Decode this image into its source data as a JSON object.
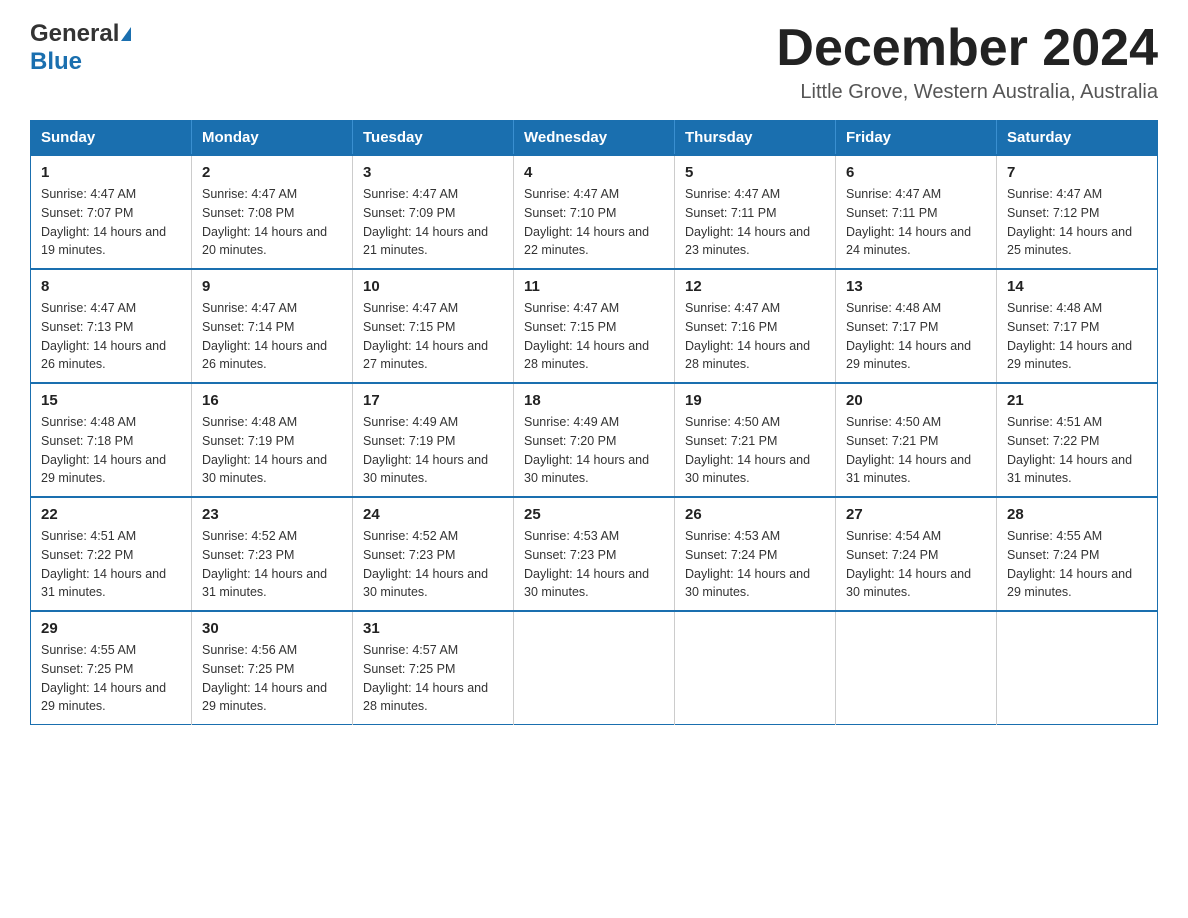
{
  "header": {
    "logo_line1": "General",
    "logo_line2": "Blue",
    "month_title": "December 2024",
    "location": "Little Grove, Western Australia, Australia"
  },
  "days_of_week": [
    "Sunday",
    "Monday",
    "Tuesday",
    "Wednesday",
    "Thursday",
    "Friday",
    "Saturday"
  ],
  "weeks": [
    [
      {
        "num": "1",
        "sunrise": "4:47 AM",
        "sunset": "7:07 PM",
        "daylight": "14 hours and 19 minutes."
      },
      {
        "num": "2",
        "sunrise": "4:47 AM",
        "sunset": "7:08 PM",
        "daylight": "14 hours and 20 minutes."
      },
      {
        "num": "3",
        "sunrise": "4:47 AM",
        "sunset": "7:09 PM",
        "daylight": "14 hours and 21 minutes."
      },
      {
        "num": "4",
        "sunrise": "4:47 AM",
        "sunset": "7:10 PM",
        "daylight": "14 hours and 22 minutes."
      },
      {
        "num": "5",
        "sunrise": "4:47 AM",
        "sunset": "7:11 PM",
        "daylight": "14 hours and 23 minutes."
      },
      {
        "num": "6",
        "sunrise": "4:47 AM",
        "sunset": "7:11 PM",
        "daylight": "14 hours and 24 minutes."
      },
      {
        "num": "7",
        "sunrise": "4:47 AM",
        "sunset": "7:12 PM",
        "daylight": "14 hours and 25 minutes."
      }
    ],
    [
      {
        "num": "8",
        "sunrise": "4:47 AM",
        "sunset": "7:13 PM",
        "daylight": "14 hours and 26 minutes."
      },
      {
        "num": "9",
        "sunrise": "4:47 AM",
        "sunset": "7:14 PM",
        "daylight": "14 hours and 26 minutes."
      },
      {
        "num": "10",
        "sunrise": "4:47 AM",
        "sunset": "7:15 PM",
        "daylight": "14 hours and 27 minutes."
      },
      {
        "num": "11",
        "sunrise": "4:47 AM",
        "sunset": "7:15 PM",
        "daylight": "14 hours and 28 minutes."
      },
      {
        "num": "12",
        "sunrise": "4:47 AM",
        "sunset": "7:16 PM",
        "daylight": "14 hours and 28 minutes."
      },
      {
        "num": "13",
        "sunrise": "4:48 AM",
        "sunset": "7:17 PM",
        "daylight": "14 hours and 29 minutes."
      },
      {
        "num": "14",
        "sunrise": "4:48 AM",
        "sunset": "7:17 PM",
        "daylight": "14 hours and 29 minutes."
      }
    ],
    [
      {
        "num": "15",
        "sunrise": "4:48 AM",
        "sunset": "7:18 PM",
        "daylight": "14 hours and 29 minutes."
      },
      {
        "num": "16",
        "sunrise": "4:48 AM",
        "sunset": "7:19 PM",
        "daylight": "14 hours and 30 minutes."
      },
      {
        "num": "17",
        "sunrise": "4:49 AM",
        "sunset": "7:19 PM",
        "daylight": "14 hours and 30 minutes."
      },
      {
        "num": "18",
        "sunrise": "4:49 AM",
        "sunset": "7:20 PM",
        "daylight": "14 hours and 30 minutes."
      },
      {
        "num": "19",
        "sunrise": "4:50 AM",
        "sunset": "7:21 PM",
        "daylight": "14 hours and 30 minutes."
      },
      {
        "num": "20",
        "sunrise": "4:50 AM",
        "sunset": "7:21 PM",
        "daylight": "14 hours and 31 minutes."
      },
      {
        "num": "21",
        "sunrise": "4:51 AM",
        "sunset": "7:22 PM",
        "daylight": "14 hours and 31 minutes."
      }
    ],
    [
      {
        "num": "22",
        "sunrise": "4:51 AM",
        "sunset": "7:22 PM",
        "daylight": "14 hours and 31 minutes."
      },
      {
        "num": "23",
        "sunrise": "4:52 AM",
        "sunset": "7:23 PM",
        "daylight": "14 hours and 31 minutes."
      },
      {
        "num": "24",
        "sunrise": "4:52 AM",
        "sunset": "7:23 PM",
        "daylight": "14 hours and 30 minutes."
      },
      {
        "num": "25",
        "sunrise": "4:53 AM",
        "sunset": "7:23 PM",
        "daylight": "14 hours and 30 minutes."
      },
      {
        "num": "26",
        "sunrise": "4:53 AM",
        "sunset": "7:24 PM",
        "daylight": "14 hours and 30 minutes."
      },
      {
        "num": "27",
        "sunrise": "4:54 AM",
        "sunset": "7:24 PM",
        "daylight": "14 hours and 30 minutes."
      },
      {
        "num": "28",
        "sunrise": "4:55 AM",
        "sunset": "7:24 PM",
        "daylight": "14 hours and 29 minutes."
      }
    ],
    [
      {
        "num": "29",
        "sunrise": "4:55 AM",
        "sunset": "7:25 PM",
        "daylight": "14 hours and 29 minutes."
      },
      {
        "num": "30",
        "sunrise": "4:56 AM",
        "sunset": "7:25 PM",
        "daylight": "14 hours and 29 minutes."
      },
      {
        "num": "31",
        "sunrise": "4:57 AM",
        "sunset": "7:25 PM",
        "daylight": "14 hours and 28 minutes."
      },
      null,
      null,
      null,
      null
    ]
  ],
  "labels": {
    "sunrise_prefix": "Sunrise: ",
    "sunset_prefix": "Sunset: ",
    "daylight_prefix": "Daylight: "
  }
}
